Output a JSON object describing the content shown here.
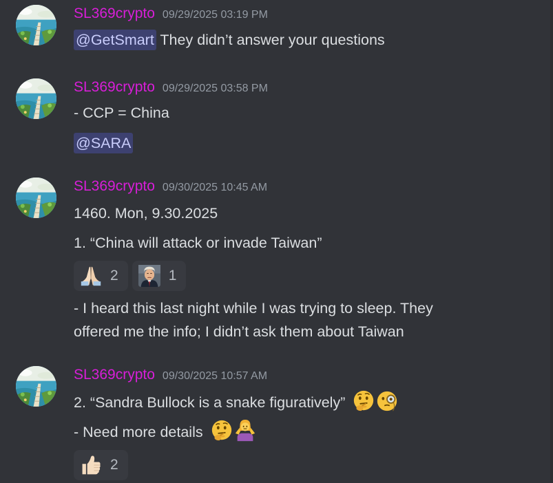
{
  "messages": [
    {
      "username": "SL369crypto",
      "timestamp": "09/29/2025 03:19 PM",
      "mention": "@GetSmart",
      "text": "They didn’t answer your questions"
    },
    {
      "username": "SL369crypto",
      "timestamp": "09/29/2025 03:58 PM",
      "line1": "- CCP = China",
      "mention": "@SARA"
    },
    {
      "username": "SL369crypto",
      "timestamp": "09/30/2025 10:45 AM",
      "line1": "1460. Mon, 9.30.2025",
      "line2": "1. “China will attack or invade Taiwan”",
      "reactions": [
        {
          "emoji": "folded-hands",
          "count": "2"
        },
        {
          "emoji": "mugshot-portrait",
          "count": "1"
        }
      ],
      "line3": "- I heard this last night while I was trying to sleep. They",
      "line4": "offered me the info; I didn’t ask them about Taiwan"
    },
    {
      "username": "SL369crypto",
      "timestamp": "09/30/2025 10:57 AM",
      "line1": "2. “Sandra Bullock is a snake figuratively”",
      "line1_emojis": [
        "thinking-face",
        "face-with-monocle"
      ],
      "line2": "- Need more details",
      "line2_emojis": [
        "thinking-face",
        "person-shrugging"
      ],
      "reactions": [
        {
          "emoji": "thumbs-up",
          "count": "2"
        }
      ]
    }
  ],
  "colors": {
    "background": "#313338",
    "username": "#d81ed8",
    "timestamp": "#949ba4",
    "text": "#dbdee1",
    "mention_bg": "#3c4270",
    "reaction_bg": "#383a40"
  }
}
